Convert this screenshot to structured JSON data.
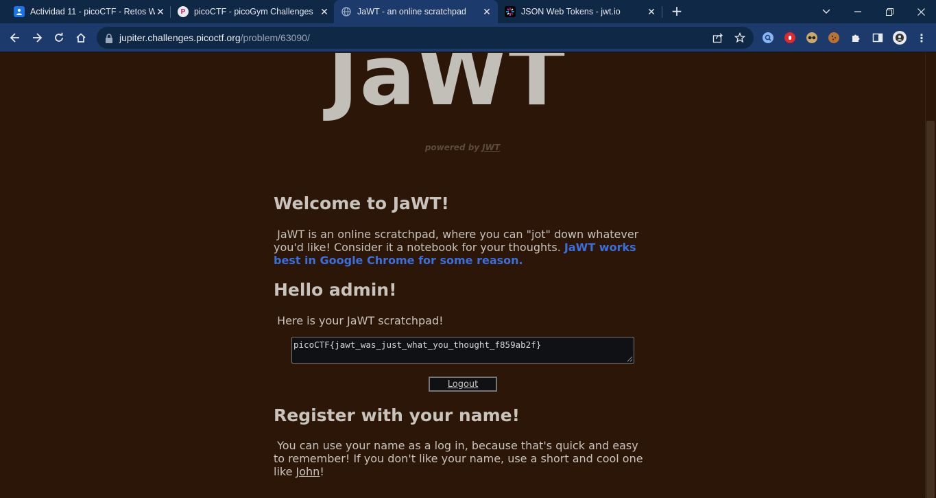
{
  "browser": {
    "tabs": [
      {
        "title": "Actividad 11 - picoCTF - Retos W",
        "favicon": "google-classroom-icon",
        "active": false
      },
      {
        "title": "picoCTF - picoGym Challenges",
        "favicon": "picoctf-icon",
        "active": false
      },
      {
        "title": "JaWT - an online scratchpad",
        "favicon": "globe-icon",
        "active": true
      },
      {
        "title": "JSON Web Tokens - jwt.io",
        "favicon": "jwt-icon",
        "active": false
      }
    ],
    "url_host": "jupiter.challenges.picoctf.org",
    "url_path": "/problem/63090/"
  },
  "page": {
    "logo": "JaWT",
    "powered_prefix": "powered by",
    "powered_link": "JWT",
    "welcome": {
      "heading": "Welcome to JaWT!",
      "text": "JaWT is an online scratchpad, where you can \"jot\" down whatever you'd like! Consider it a notebook for your thoughts.",
      "highlight": "JaWT works best in Google Chrome for some reason."
    },
    "hello": {
      "heading": "Hello admin!",
      "text": "Here is your JaWT scratchpad!",
      "scratchpad_value": "picoCTF{jawt_was_just_what_you_thought_f859ab2f}",
      "logout_label": "Logout"
    },
    "register": {
      "heading": "Register with your name!",
      "text": "You can use your name as a log in, because that's quick and easy to remember! If you don't like your name, use a short and cool one like",
      "example_name": "John",
      "suffix": "!"
    }
  },
  "colors": {
    "page_bg": "#2b1608",
    "text": "#c8c4bd",
    "link_blue": "#3b6fdb",
    "chrome_dark": "#0f2846",
    "chrome_toolbar": "#1c3a6b"
  }
}
